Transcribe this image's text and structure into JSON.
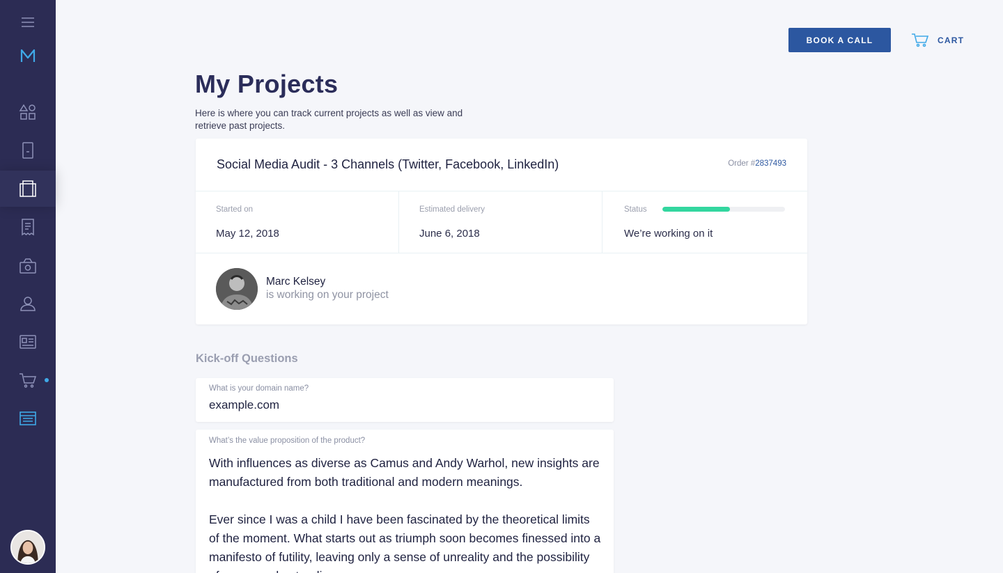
{
  "sidebar": {
    "icons": [
      "menu-icon",
      "logo-icon",
      "dashboard-icon",
      "device-icon",
      "projects-icon",
      "receipt-icon",
      "payments-icon",
      "profile-icon",
      "id-card-icon",
      "cart-icon",
      "browser-icon"
    ],
    "active_item": "projects-icon",
    "cart_badge_color": "#3fa9e8"
  },
  "header": {
    "book_call_label": "BOOK A CALL",
    "cart_label": "CART"
  },
  "page": {
    "title": "My Projects",
    "subtitle": "Here is where you can track current projects as well as view and retrieve past projects."
  },
  "project": {
    "title": "Social Media Audit - 3 Channels (Twitter, Facebook, LinkedIn)",
    "order_prefix": "Order #",
    "order_number": "2837493",
    "started_label": "Started on",
    "started_value": "May 12, 2018",
    "delivery_label": "Estimated delivery",
    "delivery_value": "June 6, 2018",
    "status_label": "Status",
    "status_value": "We’re working on it",
    "status_progress": 0.55,
    "status_color": "#33d69f",
    "worker_name": "Marc Kelsey",
    "worker_note": "is working on your project"
  },
  "kickoff": {
    "title": "Kick-off Questions",
    "q1_label": "What is your domain name?",
    "q1_value": "example.com",
    "q2_label": "What’s the value proposition of the product?",
    "q2_para1": "With influences as diverse as Camus and Andy Warhol, new insights are manufactured from both traditional and modern meanings.",
    "q2_para2": "Ever since I was a child I have been fascinated by the theoretical limits of the moment. What starts out as triumph soon becomes finessed into a manifesto of futility, leaving only a sense of unreality and the possibility of a new understanding."
  },
  "colors": {
    "sidebar_bg": "#2c2c54",
    "accent": "#2c57a0",
    "icon_active": "#3fa9e8"
  }
}
